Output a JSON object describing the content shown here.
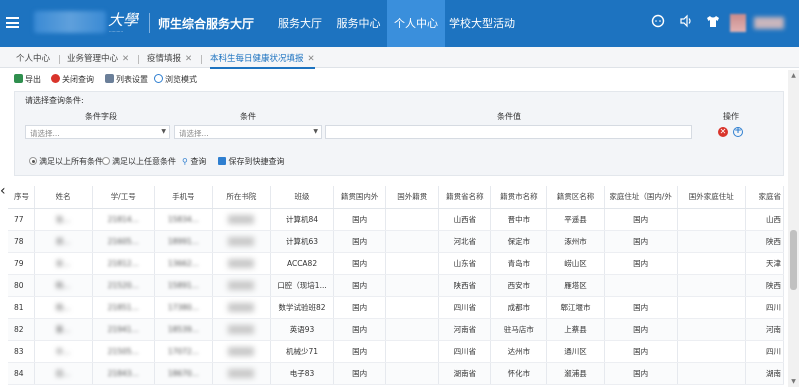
{
  "header": {
    "logo_text": "大學",
    "title": "师生综合服务大厅",
    "nav": [
      "服务大厅",
      "服务中心",
      "个人中心",
      "学校大型活动"
    ],
    "active_nav": "个人中心"
  },
  "tabs": [
    {
      "label": "个人中心",
      "closable": false
    },
    {
      "label": "业务管理中心",
      "closable": true
    },
    {
      "label": "疫情填报",
      "closable": true
    },
    {
      "label": "本科生每日健康状况填报",
      "closable": true,
      "active": true
    }
  ],
  "toolbar": {
    "export": "导出",
    "close_query": "关闭查询",
    "column_settings": "列表设置",
    "browse_mode": "浏览模式"
  },
  "query": {
    "title": "请选择查询条件:",
    "col_field": "条件字段",
    "col_condition": "条件",
    "col_value": "条件值",
    "col_action": "操作",
    "field_placeholder": "请选择...",
    "condition_placeholder": "请选择...",
    "match_all": "满足以上所有条件",
    "match_any": "满足以上任意条件",
    "search": "查询",
    "save_shortcut": "保存到快捷查询"
  },
  "table": {
    "columns": [
      "序号",
      "姓名",
      "学/工号",
      "手机号",
      "所在书院",
      "班级",
      "籍贯国内外",
      "国外籍贯",
      "籍贯省名称",
      "籍贯市名称",
      "籍贯区名称",
      "家庭住址（国内/外",
      "国外家庭住址",
      "家庭省"
    ],
    "rows": [
      {
        "no": "77",
        "name": "张...",
        "id": "21814...",
        "phone": "15834...",
        "college": "",
        "class": "计算机84",
        "dom": "国内",
        "foreign": "",
        "prov": "山西省",
        "city": "晋中市",
        "district": "平遥县",
        "addr": "国内",
        "faddr": "",
        "hprov": "山西"
      },
      {
        "no": "78",
        "name": "郑...",
        "id": "21605...",
        "phone": "18991...",
        "college": "",
        "class": "计算机63",
        "dom": "国内",
        "foreign": "",
        "prov": "河北省",
        "city": "保定市",
        "district": "涿州市",
        "addr": "国内",
        "faddr": "",
        "hprov": "陕西"
      },
      {
        "no": "79",
        "name": "宋...",
        "id": "21812...",
        "phone": "13662...",
        "college": "",
        "class": "ACCA82",
        "dom": "国内",
        "foreign": "",
        "prov": "山东省",
        "city": "青岛市",
        "district": "崂山区",
        "addr": "国内",
        "faddr": "",
        "hprov": "天津"
      },
      {
        "no": "80",
        "name": "韩...",
        "id": "21520...",
        "phone": "15891...",
        "college": "",
        "class": "口腔（现培1...",
        "dom": "国内",
        "foreign": "",
        "prov": "陕西省",
        "city": "西安市",
        "district": "雁塔区",
        "addr": "",
        "faddr": "",
        "hprov": "陕西"
      },
      {
        "no": "81",
        "name": "杨...",
        "id": "21851...",
        "phone": "17380...",
        "college": "",
        "class": "数学试验班82",
        "dom": "国内",
        "foreign": "",
        "prov": "四川省",
        "city": "成都市",
        "district": "郫江堰市",
        "addr": "国内",
        "faddr": "",
        "hprov": "四川"
      },
      {
        "no": "82",
        "name": "董...",
        "id": "21941...",
        "phone": "18539...",
        "college": "",
        "class": "英语93",
        "dom": "国内",
        "foreign": "",
        "prov": "河南省",
        "city": "驻马店市",
        "district": "上蔡县",
        "addr": "国内",
        "faddr": "",
        "hprov": "河南"
      },
      {
        "no": "83",
        "name": "许...",
        "id": "21505...",
        "phone": "17072...",
        "college": "",
        "class": "机械少71",
        "dom": "国内",
        "foreign": "",
        "prov": "四川省",
        "city": "达州市",
        "district": "通川区",
        "addr": "国内",
        "faddr": "",
        "hprov": "四川"
      },
      {
        "no": "84",
        "name": "田...",
        "id": "21843...",
        "phone": "18670...",
        "college": "",
        "class": "电子83",
        "dom": "国内",
        "foreign": "",
        "prov": "湖南省",
        "city": "怀化市",
        "district": "溆浦县",
        "addr": "国内",
        "faddr": "",
        "hprov": "湖南"
      }
    ]
  },
  "colors": {
    "header_bg": "#1d73c0",
    "nav_active": "#3a8fdc",
    "link": "#1d5fb8",
    "danger": "#d9342b"
  }
}
